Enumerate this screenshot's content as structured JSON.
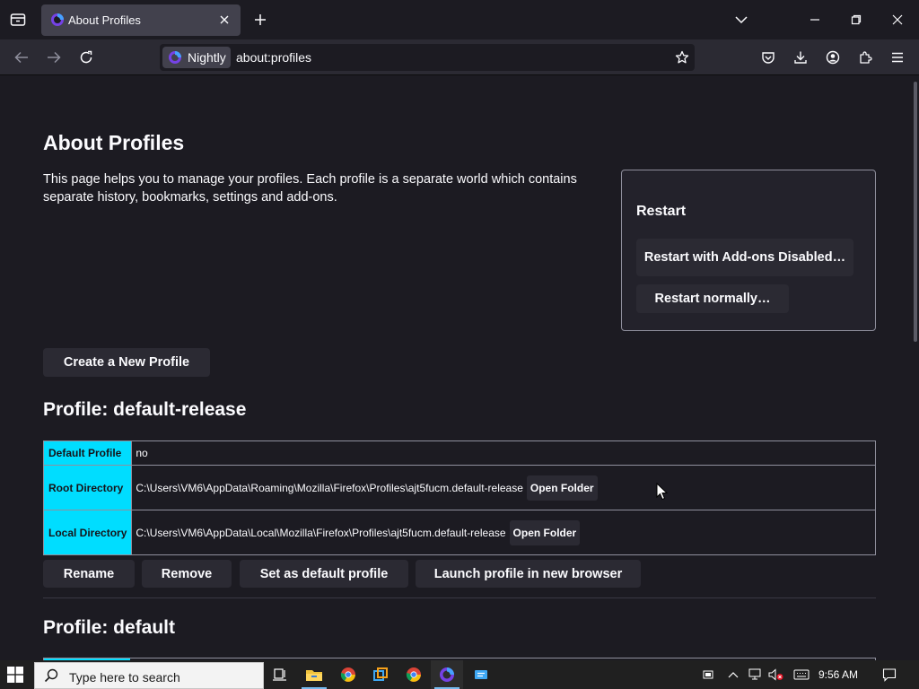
{
  "browser": {
    "tab_title": "About Profiles",
    "identity_label": "Nightly",
    "url": "about:profiles"
  },
  "page": {
    "title": "About Profiles",
    "intro": "This page helps you to manage your profiles. Each profile is a separate world which contains separate history, bookmarks, settings and add-ons.",
    "restart": {
      "heading": "Restart",
      "addons_label": "Restart with Add-ons Disabled…",
      "normal_label": "Restart normally…"
    },
    "create_label": "Create a New Profile",
    "profiles": [
      {
        "heading": "Profile: default-release",
        "rows": [
          {
            "label": "Default Profile",
            "value": "no"
          },
          {
            "label": "Root Directory",
            "value": "C:\\Users\\VM6\\AppData\\Roaming\\Mozilla\\Firefox\\Profiles\\ajt5fucm.default-release",
            "button": "Open Folder"
          },
          {
            "label": "Local Directory",
            "value": "C:\\Users\\VM6\\AppData\\Local\\Mozilla\\Firefox\\Profiles\\ajt5fucm.default-release",
            "button": "Open Folder"
          }
        ],
        "actions": {
          "rename": "Rename",
          "remove": "Remove",
          "set_default": "Set as default profile",
          "launch": "Launch profile in new browser"
        }
      },
      {
        "heading": "Profile: default"
      }
    ]
  },
  "taskbar": {
    "search_placeholder": "Type here to search",
    "time": "9:56 AM"
  },
  "colors": {
    "accent_cyan": "#00ddff",
    "content_bg": "#1c1b22",
    "toolbar_bg": "#2b2a33",
    "button_bg": "#2b2a33"
  }
}
